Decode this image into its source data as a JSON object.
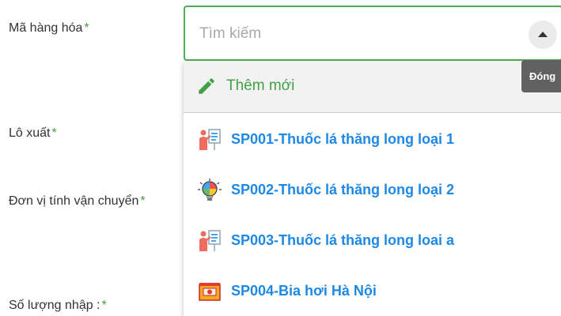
{
  "form": {
    "fields": [
      {
        "label": "Mã hàng hóa",
        "required_mark": "*"
      },
      {
        "label": "Lô xuất",
        "required_mark": "*"
      },
      {
        "label": "Đơn vị tính vận chuyển",
        "required_mark": "*"
      },
      {
        "label": "Số lượng nhập :",
        "required_mark": "*"
      }
    ]
  },
  "select": {
    "placeholder": "Tìm kiếm",
    "value": "",
    "toggle_icon": "caret-up-icon",
    "tooltip": "Đóng"
  },
  "dropdown": {
    "add_new": {
      "icon": "pencil-icon",
      "label": "Thêm mới"
    },
    "options": [
      {
        "label": "SP001-Thuốc lá thăng long loại 1",
        "icon": "presentation-icon"
      },
      {
        "label": "SP002-Thuốc lá thăng long loại 2",
        "icon": "lightbulb-icon"
      },
      {
        "label": "SP003-Thuốc lá thăng long loai a",
        "icon": "presentation-icon"
      },
      {
        "label": "SP004-Bia hơi Hà Nội",
        "icon": "product-box-icon"
      }
    ]
  },
  "colors": {
    "accent_green": "#4caf50",
    "option_blue": "#1e88e5",
    "tooltip_bg": "#616161"
  }
}
